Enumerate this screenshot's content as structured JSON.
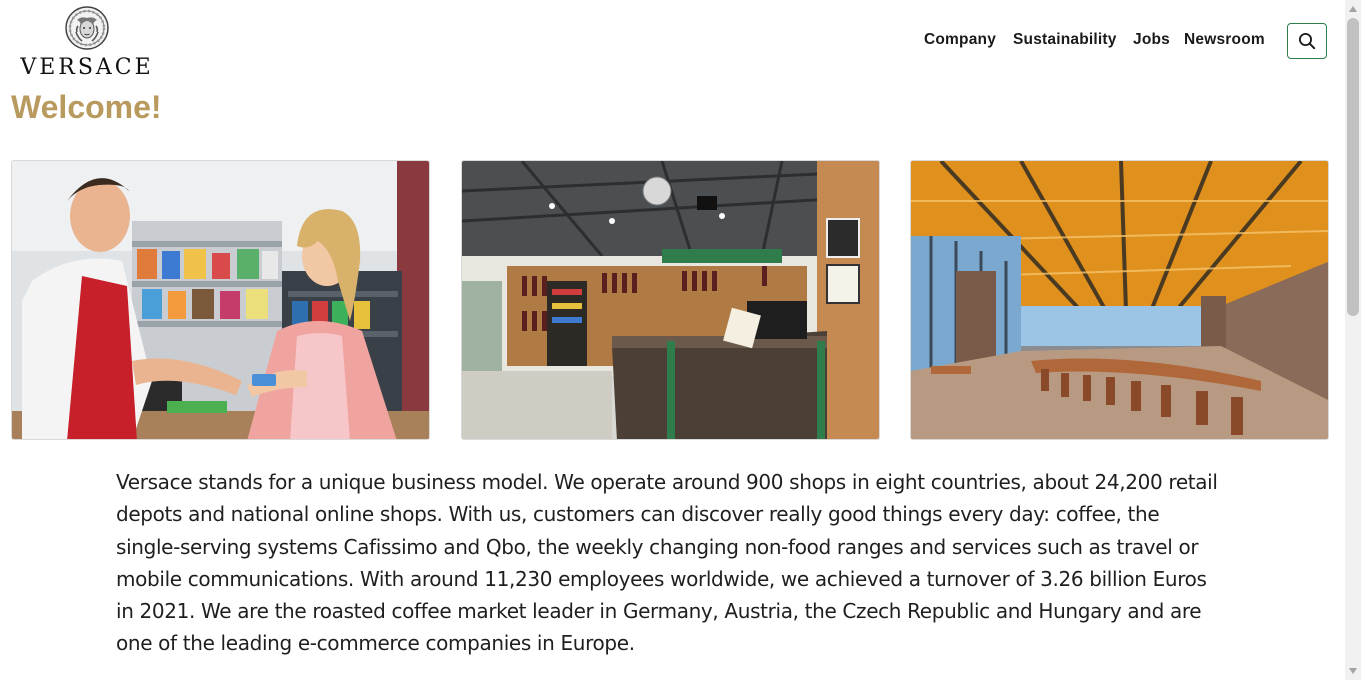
{
  "brand": {
    "name": "VERSACE",
    "logo_icon": "medusa-head-icon"
  },
  "nav": {
    "items": [
      "Company",
      "Sustainability",
      "Jobs",
      "Newsroom"
    ]
  },
  "search": {
    "icon": "search-icon",
    "accent": "#2e7d4a"
  },
  "heading": {
    "text": "Welcome!",
    "color": "#b89a5e"
  },
  "images": [
    {
      "subject": "cashier-and-customer"
    },
    {
      "subject": "shop-interior-counter"
    },
    {
      "subject": "office-cafeteria-hall"
    }
  ],
  "intro": {
    "text": "Versace stands for a unique business model. We operate around 900 shops in eight countries, about 24,200 retail depots and national online shops. With us, customers can discover really good things every day: coffee, the single-serving systems Cafissimo and Qbo, the weekly changing non-food ranges and services such as travel or mobile communications. With around 11,230 employees worldwide, we achieved a turnover of 3.26 billion Euros in 2021. We are the roasted coffee market leader in Germany, Austria, the Czech Republic and Hungary and are one of the leading e-commerce companies in Europe."
  }
}
